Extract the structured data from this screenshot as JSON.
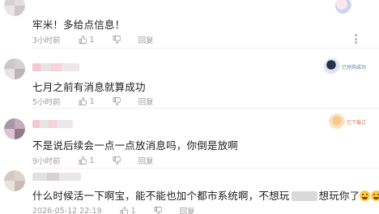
{
  "comments": [
    {
      "text": "牢米！多给点信息！",
      "time": "3小时前",
      "likes": "1",
      "reply_label": "回复"
    },
    {
      "text": "七月之前有消息就算成功",
      "time": "5小时前",
      "likes": "1",
      "reply_label": "回复",
      "badge_text": "已抢购成功"
    },
    {
      "text": "不是说后续会一点一点放消息吗，你倒是放啊",
      "time": "9小时前",
      "likes": "1",
      "reply_label": "回复",
      "badge_text": "已下载过"
    },
    {
      "text_part1": "什么时候活一下啊宝，能不能也加个都市系统啊，不想玩",
      "text_part2": "想玩你了",
      "time": "2026-05-12 22:19",
      "likes": "1",
      "reply_label": "回复"
    }
  ],
  "icons": {
    "like": "thumbs-up-icon",
    "dislike": "thumbs-down-icon",
    "more": "vertical-dots-icon",
    "emoji": "crying-laughing-emoji-icon"
  }
}
